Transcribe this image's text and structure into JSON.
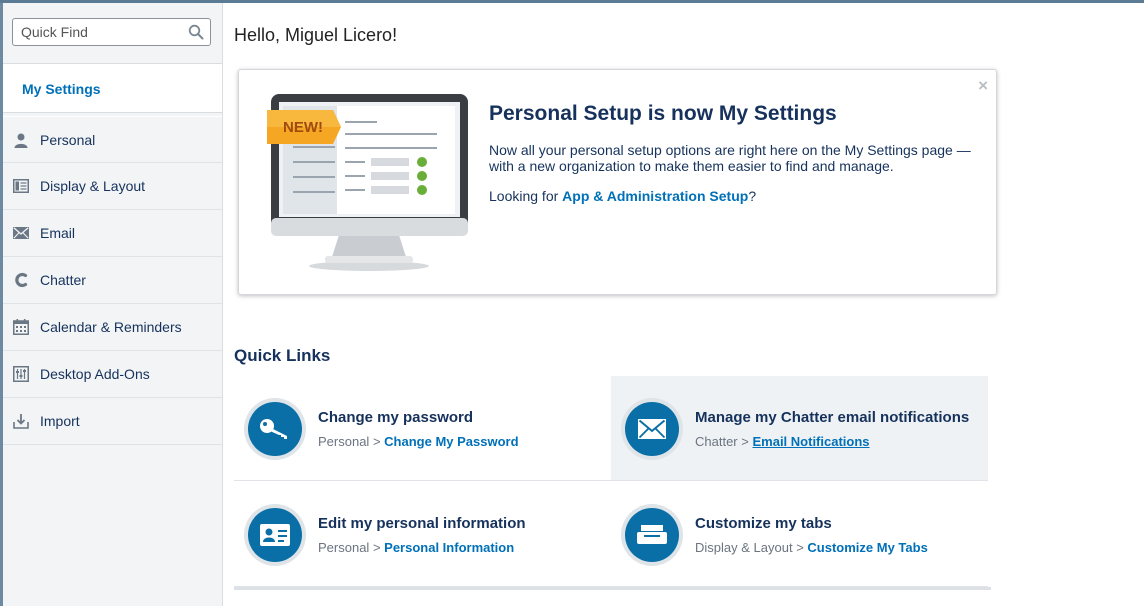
{
  "sidebar": {
    "search_placeholder": "Quick Find",
    "header": "My Settings",
    "items": [
      {
        "label": "Personal",
        "icon": "person-icon"
      },
      {
        "label": "Display & Layout",
        "icon": "layout-icon"
      },
      {
        "label": "Email",
        "icon": "envelope-icon"
      },
      {
        "label": "Chatter",
        "icon": "chatter-icon"
      },
      {
        "label": "Calendar & Reminders",
        "icon": "calendar-icon"
      },
      {
        "label": "Desktop Add-Ons",
        "icon": "sliders-icon"
      },
      {
        "label": "Import",
        "icon": "import-icon"
      }
    ]
  },
  "greeting": "Hello, Miguel Licero!",
  "banner": {
    "badge": "NEW!",
    "title": "Personal Setup is now My Settings",
    "body": "Now all your personal setup options are right here on the My Settings page —with a new organization to make them easier to find and manage.",
    "link_prefix": "Looking for ",
    "link_text": "App & Administration Setup",
    "link_suffix": "?",
    "close": "×"
  },
  "quick_links": {
    "title": "Quick Links",
    "sep": ">",
    "items": [
      {
        "title": "Change my password",
        "crumb": "Personal",
        "link": "Change My Password",
        "icon": "key-icon"
      },
      {
        "title": "Manage my Chatter email notifications",
        "crumb": "Chatter",
        "link": "Email Notifications",
        "icon": "envelope-icon"
      },
      {
        "title": "Edit my personal information",
        "crumb": "Personal",
        "link": "Personal Information",
        "icon": "id-card-icon"
      },
      {
        "title": "Customize my tabs",
        "crumb": "Display & Layout",
        "link": "Customize My Tabs",
        "icon": "tabs-icon"
      }
    ]
  },
  "colors": {
    "accent": "#0070b8",
    "text": "#16325c",
    "icon_circle": "#0a6fa6",
    "badge": "#f5a623"
  }
}
